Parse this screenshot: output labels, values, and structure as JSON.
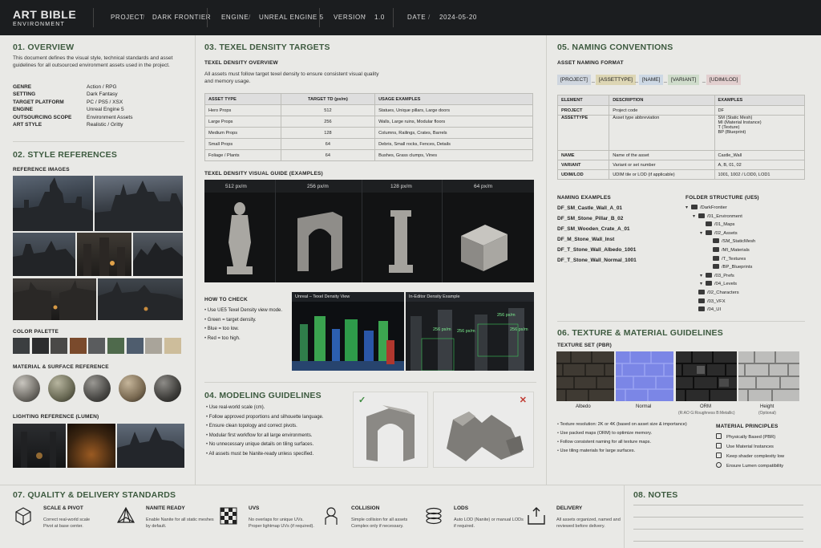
{
  "header": {
    "title": "ART BIBLE",
    "subtitle": "ENVIRONMENT",
    "project_label": "PROJECT",
    "project": "DARK FRONTIER",
    "engine_label": "ENGINE",
    "engine": "UNREAL ENGINE 5",
    "version_label": "VERSION",
    "version": "1.0",
    "date_label": "DATE",
    "date": "2024-05-20",
    "sep": "/"
  },
  "overview": {
    "heading": "01. OVERVIEW",
    "text": "This document defines the visual style, technical standards and asset guidelines for all outsourced environment assets used in the project.",
    "rows": [
      {
        "k": "GENRE",
        "v": "Action / RPG"
      },
      {
        "k": "SETTING",
        "v": "Dark Fantasy"
      },
      {
        "k": "TARGET PLATFORM",
        "v": "PC / PS5 / XSX"
      },
      {
        "k": "ENGINE",
        "v": "Unreal Engine 5"
      },
      {
        "k": "OUTSOURCING SCOPE",
        "v": "Environment Assets"
      },
      {
        "k": "ART STYLE",
        "v": "Realistic / Gritty"
      }
    ]
  },
  "style": {
    "heading": "02. STYLE REFERENCES",
    "ref_images": "REFERENCE IMAGES",
    "palette_label": "COLOR PALETTE",
    "palette": [
      "#3b3e40",
      "#2c2d2e",
      "#4a4947",
      "#7a4a2c",
      "#5a5c5e",
      "#4f6a4c",
      "#4f5d6e",
      "#a9a49a",
      "#cdbd9b"
    ],
    "material_label": "MATERIAL & SURFACE REFERENCE",
    "lighting_label": "LIGHTING REFERENCE (LUMEN)"
  },
  "texel": {
    "heading": "03. TEXEL DENSITY TARGETS",
    "overview_label": "TEXEL DENSITY OVERVIEW",
    "text": "All assets must follow target texel density to ensure consistent visual quality and memory usage.",
    "columns": [
      "ASSET TYPE",
      "TARGET TD (px/m)",
      "USAGE EXAMPLES"
    ],
    "rows": [
      [
        "Hero Props",
        "512",
        "Statues, Unique pillars, Large doors"
      ],
      [
        "Large Props",
        "256",
        "Walls, Large ruins, Modular floors"
      ],
      [
        "Medium Props",
        "128",
        "Columns, Railings, Crates, Barrels"
      ],
      [
        "Small Props",
        "64",
        "Debris, Small rocks, Fences, Details"
      ],
      [
        "Foliage / Plants",
        "64",
        "Bushes, Grass clumps, Vines"
      ]
    ],
    "guide_label": "TEXEL DENSITY VISUAL GUIDE (EXAMPLES)",
    "guide": [
      "512 px/m",
      "256 px/m",
      "128 px/m",
      "64 px/m"
    ],
    "check_label": "HOW TO CHECK",
    "check_items": [
      "Use UE5 Texel Density view mode.",
      "Green = target density.",
      "Blue = too low.",
      "Red = too high."
    ],
    "view1": "Unreal – Texel Density View",
    "view2": "In-Editor Density Example",
    "marks": [
      "256 px/m",
      "256 px/m",
      "256 px/m",
      "256 px/m"
    ]
  },
  "modeling": {
    "heading": "04. MODELING GUIDELINES",
    "items": [
      "Use real-world scale (cm).",
      "Follow approved proportions and silhouette language.",
      "Ensure clean topology and correct pivots.",
      "Modular first workflow for all large environments.",
      "No unnecessary unique details on tiling surfaces.",
      "All assets must be Nanite-ready unless specified."
    ],
    "good": "✓",
    "bad": "✕"
  },
  "naming": {
    "heading": "05. NAMING CONVENTIONS",
    "format_label": "ASSET NAMING FORMAT",
    "format": [
      "[PROJECT]",
      "[ASSETTYPE]",
      "[NAME]",
      "[VARIANT]",
      "[UDIM/LOD]"
    ],
    "us": "_",
    "columns": [
      "ELEMENT",
      "DESCRIPTION",
      "EXAMPLES"
    ],
    "rows": [
      [
        "PROJECT",
        "Project code",
        "DF"
      ],
      [
        "ASSETTYPE",
        "Asset type abbreviation",
        "SM (Static Mesh)\nMI (Material Instance)\nT (Texture)\nBP (Blueprint)"
      ],
      [
        "NAME",
        "Name of the asset",
        "Castle_Wall"
      ],
      [
        "VARIANT",
        "Variant or set number",
        "A, B, 01, 02"
      ],
      [
        "UDIM/LOD",
        "UDIM tile or LOD (if applicable)",
        "1001, 1002 / LOD0, LOD1"
      ]
    ],
    "examples_label": "NAMING EXAMPLES",
    "examples": [
      "DF_SM_Castle_Wall_A_01",
      "DF_SM_Stone_Pillar_B_02",
      "DF_SM_Wooden_Crate_A_01",
      "DF_M_Stone_Wall_Inst",
      "DF_T_Stone_Wall_Albedo_1001",
      "DF_T_Stone_Wall_Normal_1001"
    ],
    "folder_label": "FOLDER STRUCTURE (UE5)",
    "folders": [
      "/DarkFrontier",
      "/01_Environment",
      "/01_Maps",
      "/02_Assets",
      "/SM_StaticMesh",
      "/MI_Materials",
      "/T_Textures",
      "/BP_Blueprints",
      "/03_Prefs",
      "/04_Levels",
      "/02_Characters",
      "/03_VFX",
      "/04_UI"
    ]
  },
  "texture": {
    "heading": "06. TEXTURE & MATERIAL GUIDELINES",
    "set_label": "TEXTURE SET (PBR)",
    "maps": [
      "Albedo",
      "Normal",
      "ORM",
      "Height"
    ],
    "orm_note": "(R:AO G:Roughness B:Metallic)",
    "height_note": "(Optional)",
    "items": [
      "Texture resolution: 2K or 4K (based on asset size & importance)",
      "Use packed maps (ORM) to optimize memory.",
      "Follow consistent naming for all texture maps.",
      "Use tiling materials for large surfaces."
    ],
    "principles_label": "MATERIAL PRINCIPLES",
    "principles": [
      "Physically Based (PBR)",
      "Use Material Instances",
      "Keep shader complexity low",
      "Ensure Lumen compatibility"
    ]
  },
  "quality": {
    "heading": "07. QUALITY & DELIVERY STANDARDS",
    "items": [
      {
        "name": "SCALE & PIVOT",
        "desc": "Correct real-world scale\nPivot at base center."
      },
      {
        "name": "NANITE READY",
        "desc": "Enable Nanite for all static meshes by default."
      },
      {
        "name": "UVS",
        "desc": "No overlaps for unique UVs.\nProper lightmap UVs (if required)."
      },
      {
        "name": "COLLISION",
        "desc": "Simple collision for all assets\nComplex only if necessary."
      },
      {
        "name": "LODS",
        "desc": "Auto LOD (Nanite) or manual LODs if required."
      },
      {
        "name": "DELIVERY",
        "desc": "All assets organized, named and reviewed before delivery."
      }
    ]
  },
  "notes": {
    "heading": "08. NOTES"
  }
}
